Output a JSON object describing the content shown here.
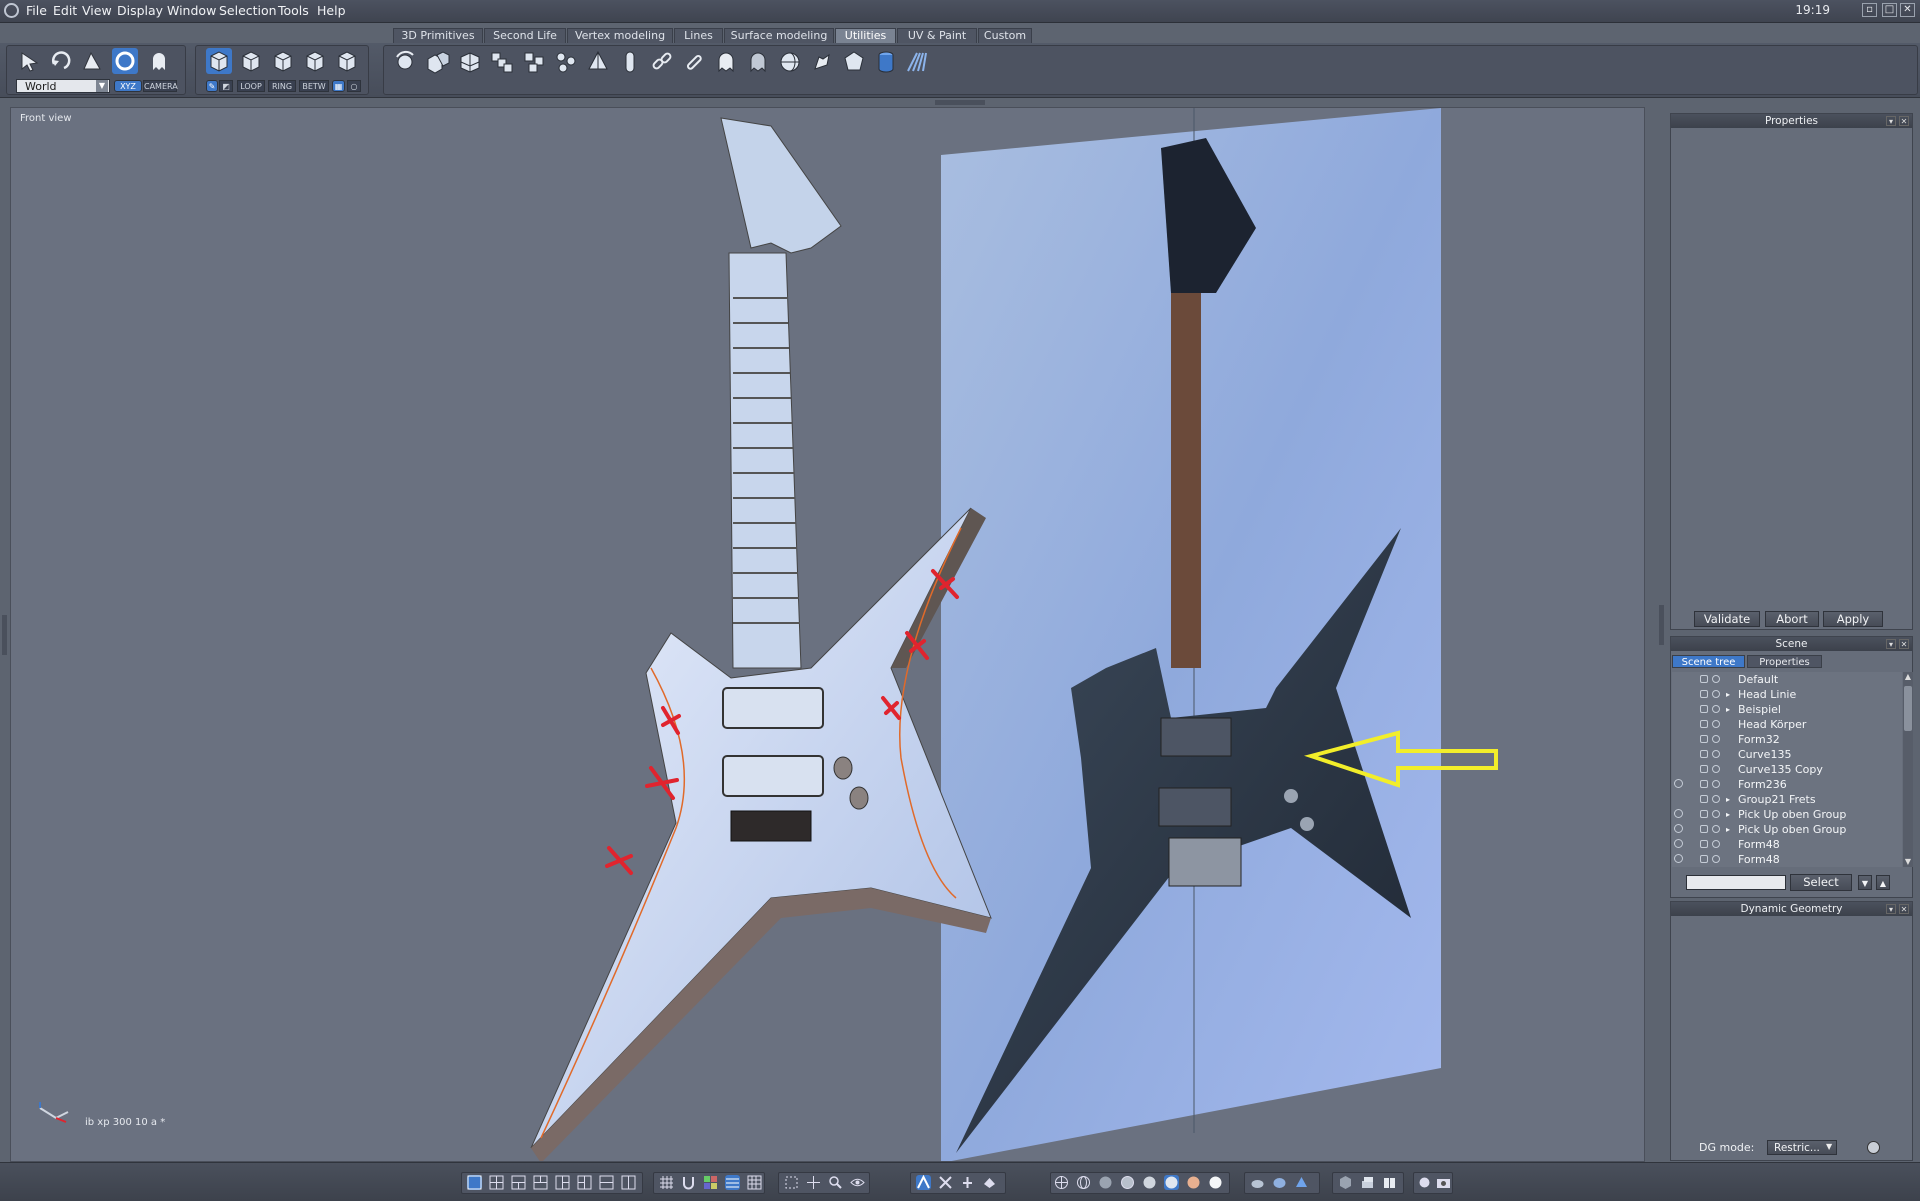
{
  "menubar": {
    "items": [
      "File",
      "Edit",
      "View",
      "Display",
      "Window",
      "Selection",
      "Tools",
      "Help"
    ],
    "clock": "19:19"
  },
  "tabs": [
    "3D Primitives",
    "Second Life",
    "Vertex modeling",
    "Lines",
    "Surface modeling",
    "Utilities",
    "UV & Paint",
    "Custom"
  ],
  "active_tab": "Utilities",
  "toolbar": {
    "coord_space": "World",
    "xyz_label": "XYZ",
    "camera_label": "CAMERA",
    "loop_label": "LOOP",
    "ring_label": "RING",
    "betw_label": "BETW"
  },
  "viewport": {
    "label": "Front view",
    "filename": "ib xp 300 10 a *"
  },
  "properties_panel": {
    "title": "Properties",
    "validate_label": "Validate",
    "abort_label": "Abort",
    "apply_label": "Apply"
  },
  "scene_panel": {
    "title": "Scene",
    "tabs": [
      "Scene tree",
      "Properties"
    ],
    "items": [
      {
        "name": "Default",
        "expanded_marker": false,
        "has_circle": false
      },
      {
        "name": "Head Linie",
        "expanded_marker": true,
        "has_circle": false
      },
      {
        "name": "Beispiel",
        "expanded_marker": true,
        "has_circle": false
      },
      {
        "name": "Head Körper",
        "expanded_marker": false,
        "has_circle": false
      },
      {
        "name": "Form32",
        "expanded_marker": false,
        "has_circle": false
      },
      {
        "name": "Curve135",
        "expanded_marker": false,
        "has_circle": false
      },
      {
        "name": "Curve135 Copy",
        "expanded_marker": false,
        "has_circle": false
      },
      {
        "name": "Form236",
        "expanded_marker": false,
        "has_circle": true
      },
      {
        "name": "Group21 Frets",
        "expanded_marker": true,
        "has_circle": false
      },
      {
        "name": "Pick Up oben Group",
        "expanded_marker": true,
        "has_circle": true
      },
      {
        "name": "Pick Up oben Group",
        "expanded_marker": true,
        "has_circle": true
      },
      {
        "name": "Form48",
        "expanded_marker": false,
        "has_circle": true
      },
      {
        "name": "Form48",
        "expanded_marker": false,
        "has_circle": true
      }
    ],
    "select_label": "Select"
  },
  "dynamic_geometry_panel": {
    "title": "Dynamic Geometry",
    "dg_mode_label": "DG mode:",
    "dg_mode_value": "Restric..."
  },
  "colors": {
    "accent": "#3e78c8",
    "annotation_arrow": "#f2ee2a",
    "cross_marks": "#e0242e"
  }
}
